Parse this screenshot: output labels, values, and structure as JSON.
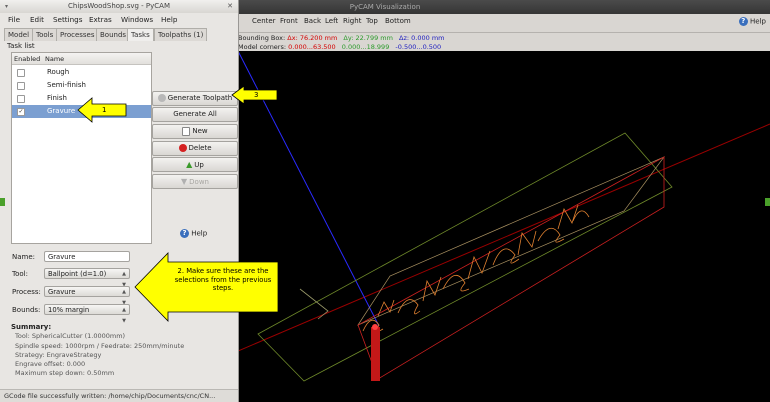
{
  "viz": {
    "title": "PyCAM Visualization",
    "toolbar": [
      "Center",
      "Front",
      "Back",
      "Left",
      "Right",
      "Top",
      "Bottom"
    ],
    "help_label": "Help",
    "bbox_label": "Bounding Box:",
    "dx": "Δx: 76.200 mm",
    "dy": "Δy: 22.799 mm",
    "dz": "Δz: 0.000 mm",
    "corners_label": "Model corners:",
    "corner_x": "0.000...63.500",
    "corner_y": "0.000...18.999",
    "corner_z": "-0.500...0.500"
  },
  "window": {
    "title": "ChipsWoodShop.svg - PyCAM"
  },
  "menu": [
    "File",
    "Edit",
    "Settings",
    "Extras",
    "Windows",
    "Help"
  ],
  "tabs": [
    "Model",
    "Tools",
    "Processes",
    "Bounds",
    "Tasks",
    "Toolpaths (1)"
  ],
  "tasklist": {
    "label": "Task list",
    "col_enabled": "Enabled",
    "col_name": "Name",
    "rows": [
      {
        "name": "Rough",
        "checked": false
      },
      {
        "name": "Semi-finish",
        "checked": false
      },
      {
        "name": "Finish",
        "checked": false
      },
      {
        "name": "Gravure",
        "checked": true
      }
    ]
  },
  "buttons": {
    "generate_toolpath": "Generate Toolpath",
    "generate_all": "Generate All",
    "new": "New",
    "delete": "Delete",
    "up": "Up",
    "down": "Down",
    "help": "Help"
  },
  "form": {
    "name_label": "Name:",
    "name_value": "Gravure",
    "tool_label": "Tool:",
    "tool_value": "Ballpoint (d=1.0)",
    "process_label": "Process:",
    "process_value": "Gravure",
    "bounds_label": "Bounds:",
    "bounds_value": "10% margin"
  },
  "summary": {
    "title": "Summary:",
    "lines": [
      "Tool: SphericalCutter (1.0000mm)",
      "Spindle speed: 1000rpm / Feedrate: 250mm/minute",
      "Strategy: EngraveStrategy",
      "Engrave offset: 0.000",
      "Maximum step down: 0.50mm"
    ]
  },
  "status": "GCode file successfully written: /home/chip/Documents/cnc/CN...",
  "callouts": {
    "c1": "1",
    "c2": "2. Make sure these are the selections from the previous steps.",
    "c3": "3"
  },
  "colors": {
    "dx": "#d40000",
    "dy": "#2a9a2a",
    "dz": "#2020c0",
    "callout": "#ffff00",
    "selection": "#7b9fd1"
  }
}
